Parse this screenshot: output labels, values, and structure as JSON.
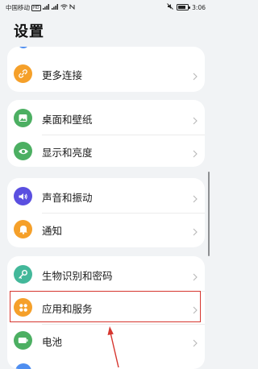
{
  "status_bar": {
    "carrier": "中国移动",
    "network_badge": "HD",
    "signal_icons": [
      "signal-4g-icon",
      "signal-icon",
      "wifi-icon",
      "nfc-icon"
    ],
    "time": "3:06",
    "mute_icon": "mute-icon",
    "battery_icon": "battery-icon"
  },
  "page": {
    "title": "设置"
  },
  "menu": {
    "top_card": [
      {
        "label": "更多连接",
        "icon": "link-icon",
        "color": "#f5a02a"
      }
    ],
    "display_card": [
      {
        "label": "桌面和壁纸",
        "icon": "wallpaper-icon",
        "color": "#4caf62"
      },
      {
        "label": "显示和亮度",
        "icon": "eye-icon",
        "color": "#4caf62"
      }
    ],
    "sound_card": [
      {
        "label": "声音和振动",
        "icon": "speaker-icon",
        "color": "#5a4fe0"
      },
      {
        "label": "通知",
        "icon": "bell-icon",
        "color": "#f5a02a"
      }
    ],
    "security_card": [
      {
        "label": "生物识别和密码",
        "icon": "key-icon",
        "color": "#43b89a"
      },
      {
        "label": "应用和服务",
        "icon": "apps-icon",
        "color": "#f5a02a"
      },
      {
        "label": "电池",
        "icon": "battery-setting-icon",
        "color": "#4caf62"
      }
    ]
  },
  "annotation": {
    "highlight_color": "#d6362f"
  }
}
